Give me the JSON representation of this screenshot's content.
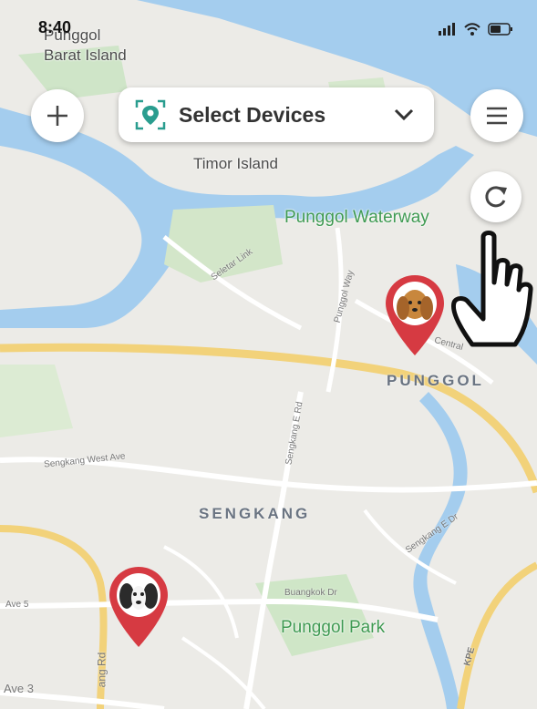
{
  "status_bar": {
    "time": "8:40"
  },
  "top_bar": {
    "device_select_label": "Select Devices"
  },
  "map_labels": {
    "punggol_barat": "Punggol\nBarat Island",
    "timor": "Timor Island",
    "punggol_waterway": "Punggol Waterway",
    "punggol": "PUNGGOL",
    "sengkang": "SENGKANG",
    "punggol_park": "Punggol Park",
    "seletar_link": "Seletar Link",
    "punggol_way": "Punggol Way",
    "sengkang_e_rd": "Sengkang E Rd",
    "sengkang_west_ave": "Sengkang West Ave",
    "sengkang_e_dr": "Sengkang E Dr",
    "buangkok_dr": "Buangkok Dr",
    "kpe": "KPE",
    "ave_3": "Ave 3",
    "ave_5": "Ave 5",
    "central": "Central",
    "ang_rd": "ang Rd"
  },
  "icons": {
    "add": "plus-icon",
    "menu": "hamburger-icon",
    "refresh": "refresh-icon",
    "location": "location-pin-icon",
    "chevron": "chevron-down-icon",
    "pointer": "hand-pointer-icon"
  },
  "colors": {
    "water": "#9fc8ea",
    "pin": "#d63a42",
    "park": "#3f9a52",
    "expressway": "#f2d27a"
  }
}
